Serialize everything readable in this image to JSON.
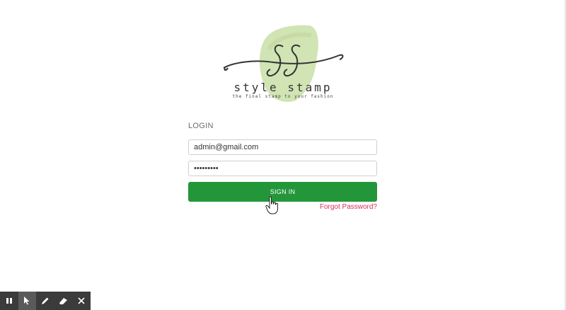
{
  "logo": {
    "name": "style stamp",
    "tagline": "the final stamp to your fashion"
  },
  "login": {
    "heading": "LOGIN",
    "email_value": "admin@gmail.com",
    "password_value": "•••••••••",
    "signin_label": "SIGN IN",
    "forgot_label": "Forgot Password?"
  },
  "toolbar": {
    "tools": [
      "pause-icon",
      "pointer-icon",
      "pen-icon",
      "eraser-icon",
      "close-icon"
    ]
  },
  "colors": {
    "primary_button": "#24963a",
    "link": "#d2325a",
    "logo_splash": "#cfe3b0"
  }
}
